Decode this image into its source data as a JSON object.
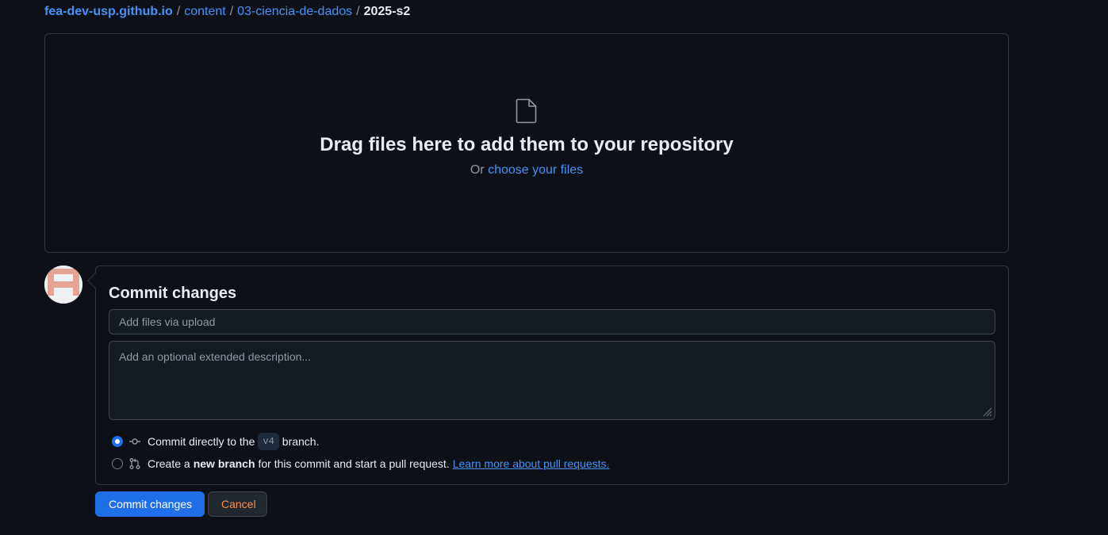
{
  "breadcrumb": {
    "repo": "fea-dev-usp.github.io",
    "separator": "/",
    "path": [
      "content",
      "03-ciencia-de-dados"
    ],
    "current": "2025-s2"
  },
  "dropzone": {
    "icon": "file-icon",
    "title": "Drag files here to add them to your repository",
    "or_text": "Or",
    "choose_link": "choose your files"
  },
  "commit": {
    "avatar": "identicon-avatar",
    "title": "Commit changes",
    "summary_placeholder": "Add files via upload",
    "description_placeholder": "Add an optional extended description...",
    "option_direct": {
      "selected": true,
      "icon": "git-commit-icon",
      "prefix": "Commit directly to the",
      "branch": "v4",
      "suffix": "branch."
    },
    "option_new_branch": {
      "selected": false,
      "icon": "git-pull-request-icon",
      "prefix": "Create a",
      "bold": "new branch",
      "suffix": "for this commit and start a pull request.",
      "link": "Learn more about pull requests."
    }
  },
  "buttons": {
    "commit": "Commit changes",
    "cancel": "Cancel"
  },
  "colors": {
    "background": "#0d1117",
    "accent": "#1f6feb",
    "link": "#4493f8",
    "cancel_text": "#ff8e4b",
    "border": "#30363d"
  }
}
